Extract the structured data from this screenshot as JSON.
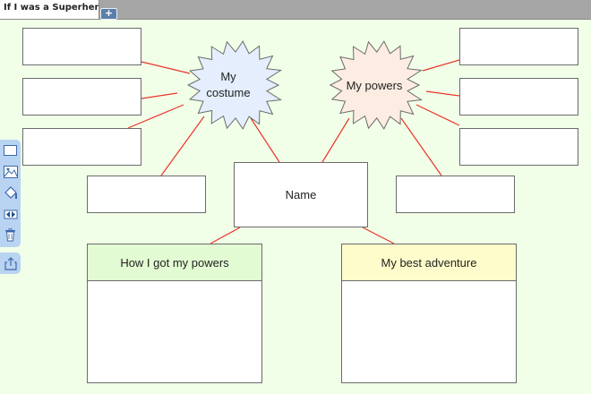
{
  "tab": {
    "title": "If I was a Superhero ...",
    "add_label": "+"
  },
  "bursts": {
    "costume": {
      "line1": "My",
      "line2": "costume"
    },
    "powers": {
      "label": "My powers"
    }
  },
  "name_box": {
    "label": "Name"
  },
  "sections": {
    "powers_origin": {
      "label": "How I got my powers"
    },
    "adventure": {
      "label": "My best adventure"
    }
  },
  "toolbar": {
    "icons": [
      "rectangle-icon",
      "image-icon",
      "fill-icon",
      "arrange-icon",
      "trash-icon"
    ],
    "share_icon": "share-icon"
  },
  "colors": {
    "background": "#f2ffe8",
    "connector": "#e8362b",
    "costume_burst": "#e4eefc",
    "powers_burst": "#fcece2",
    "powers_origin_header": "#e2fbd2",
    "adventure_header": "#fefcca"
  }
}
